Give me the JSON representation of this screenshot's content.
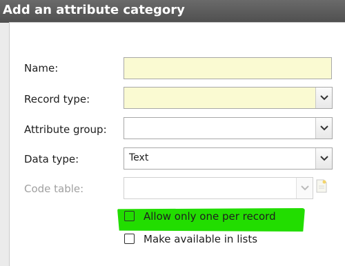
{
  "dialog": {
    "title": "Add an attribute category"
  },
  "form": {
    "name": {
      "label": "Name:",
      "value": ""
    },
    "record_type": {
      "label": "Record type:",
      "value": ""
    },
    "attribute_group": {
      "label": "Attribute group:",
      "value": ""
    },
    "data_type": {
      "label": "Data type:",
      "value": "Text"
    },
    "code_table": {
      "label": "Code table:",
      "value": "",
      "enabled": false
    },
    "allow_one_per_record": {
      "label": "Allow only one per record",
      "checked": false,
      "highlighted": true
    },
    "make_available_in_lists": {
      "label": "Make available in lists",
      "checked": false
    }
  },
  "colors": {
    "title_bar": "#5a5a5a",
    "required_field_bg": "#fafad2",
    "highlight": "#22dd00"
  }
}
